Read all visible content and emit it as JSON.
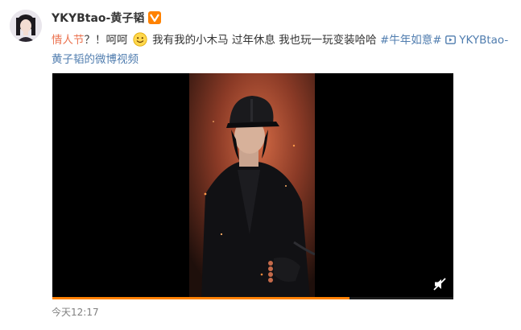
{
  "author": {
    "name": "YKYBtao-黄子韬",
    "verified_icon": "verified-badge-icon"
  },
  "post": {
    "tag_valentines": "情人节",
    "text_part1": "？！呵呵",
    "emoji": "smile-emoji-icon",
    "text_part2": "我有我的小木马 过年休息 我也玩一玩变装哈哈",
    "hashtag": "#牛年如意#",
    "video_link": "YKYBtao-黄子韬的微博视频"
  },
  "video": {
    "progress": 0.74,
    "mute_icon": "mute-icon",
    "accent_color": "#ff8200"
  },
  "meta": {
    "timestamp": "今天12:17"
  }
}
